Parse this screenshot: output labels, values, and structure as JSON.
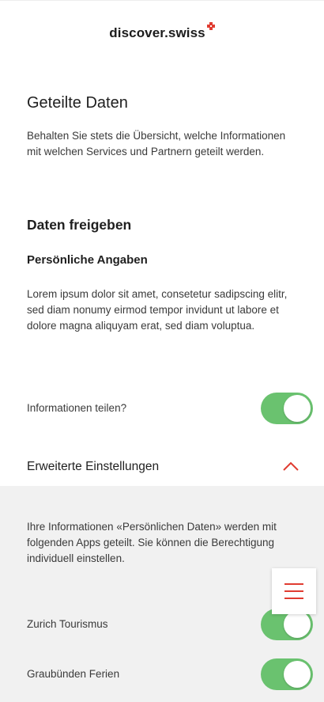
{
  "header": {
    "logo_text": "discover.swiss"
  },
  "shared": {
    "title": "Geteilte Daten",
    "description": "Behalten Sie stets die Übersicht, welche Informationen mit welchen Services und Partnern geteilt werden."
  },
  "release": {
    "title": "Daten freigeben",
    "personal_title": "Persönliche Angaben",
    "personal_text": "Lorem ipsum dolor sit amet, consetetur sadipscing elitr, sed diam nonumy eirmod tempor invidunt ut labore et dolore magna aliquyam erat, sed diam voluptua.",
    "share_label": "Informationen teilen?",
    "share_on": true
  },
  "advanced": {
    "title": "Erweiterte Einstellungen",
    "expanded": true,
    "description": "Ihre Informationen «Persönlichen Daten» werden mit folgenden Apps geteilt. Sie können die Berechtigung individuell einstellen.",
    "apps": [
      {
        "label": "Zurich Tourismus",
        "on": true
      },
      {
        "label": "Graubünden Ferien",
        "on": true
      }
    ]
  },
  "icons": {
    "logo_mark": "swiss-cross-icon",
    "collapse": "chevron-up-icon",
    "menu": "hamburger-menu-icon"
  },
  "colors": {
    "accent_red": "#e03c31",
    "toggle_on": "#6ac26f",
    "panel_bg": "#f1f1f1"
  }
}
